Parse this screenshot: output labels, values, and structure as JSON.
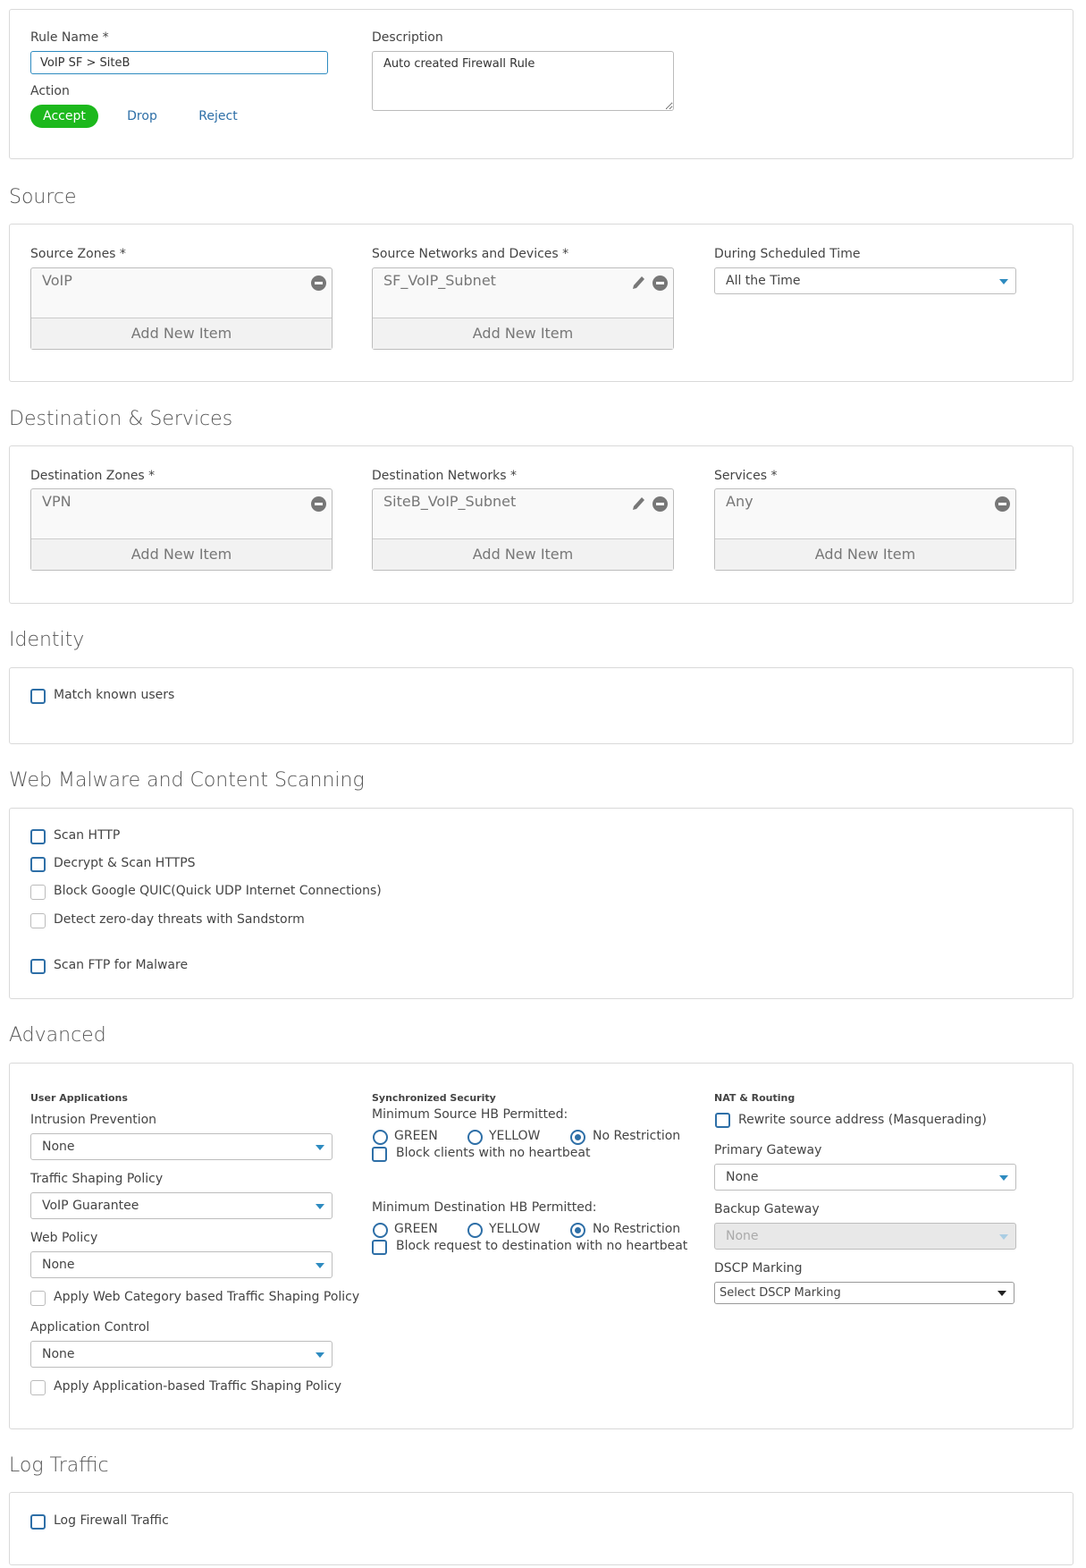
{
  "rule": {
    "name_label": "Rule Name *",
    "name_value": "VoIP SF > SiteB",
    "description_label": "Description",
    "description_value": "Auto created Firewall Rule",
    "action_label": "Action",
    "actions": [
      "Accept",
      "Drop",
      "Reject"
    ],
    "selected_action": "Accept"
  },
  "source": {
    "title": "Source",
    "zones_label": "Source Zones *",
    "zones_item": "VoIP",
    "networks_label": "Source Networks and Devices *",
    "networks_item": "SF_VoIP_Subnet",
    "schedule_label": "During Scheduled Time",
    "schedule_value": "All the Time",
    "add_new": "Add New Item"
  },
  "destination": {
    "title": "Destination & Services",
    "zones_label": "Destination Zones *",
    "zones_item": "VPN",
    "networks_label": "Destination Networks *",
    "networks_item": "SiteB_VoIP_Subnet",
    "services_label": "Services *",
    "services_item": "Any",
    "add_new": "Add New Item"
  },
  "identity": {
    "title": "Identity",
    "match_known_users": "Match known users"
  },
  "scanning": {
    "title": "Web Malware and Content Scanning",
    "scan_http": "Scan HTTP",
    "decrypt_https": "Decrypt & Scan HTTPS",
    "block_quic": "Block Google QUIC(Quick UDP Internet Connections)",
    "sandstorm": "Detect zero-day threats with Sandstorm",
    "scan_ftp": "Scan FTP for Malware"
  },
  "advanced": {
    "title": "Advanced",
    "user_apps": {
      "heading": "User Applications",
      "ips_label": "Intrusion Prevention",
      "ips_value": "None",
      "shaping_label": "Traffic Shaping Policy",
      "shaping_value": "VoIP Guarantee",
      "web_label": "Web Policy",
      "web_value": "None",
      "web_category_shaping": "Apply Web Category based Traffic Shaping Policy",
      "app_control_label": "Application Control",
      "app_control_value": "None",
      "app_shaping": "Apply Application-based Traffic Shaping Policy"
    },
    "sync_security": {
      "heading": "Synchronized Security",
      "min_source_label": "Minimum Source HB Permitted:",
      "min_dest_label": "Minimum Destination HB Permitted:",
      "options": [
        "GREEN",
        "YELLOW",
        "No Restriction"
      ],
      "source_selected": "No Restriction",
      "dest_selected": "No Restriction",
      "block_clients": "Block clients with no heartbeat",
      "block_dest": "Block request to destination with no heartbeat"
    },
    "nat": {
      "heading": "NAT & Routing",
      "rewrite": "Rewrite source address (Masquerading)",
      "primary_label": "Primary Gateway",
      "primary_value": "None",
      "backup_label": "Backup Gateway",
      "backup_value": "None",
      "dscp_label": "DSCP Marking",
      "dscp_value": "Select DSCP Marking"
    }
  },
  "log": {
    "title": "Log Traffic",
    "log_firewall": "Log Firewall Traffic"
  },
  "colors": {
    "accent": "#2e8bc0",
    "accept_green": "#1cb81c",
    "border": "#d9d9d9"
  }
}
